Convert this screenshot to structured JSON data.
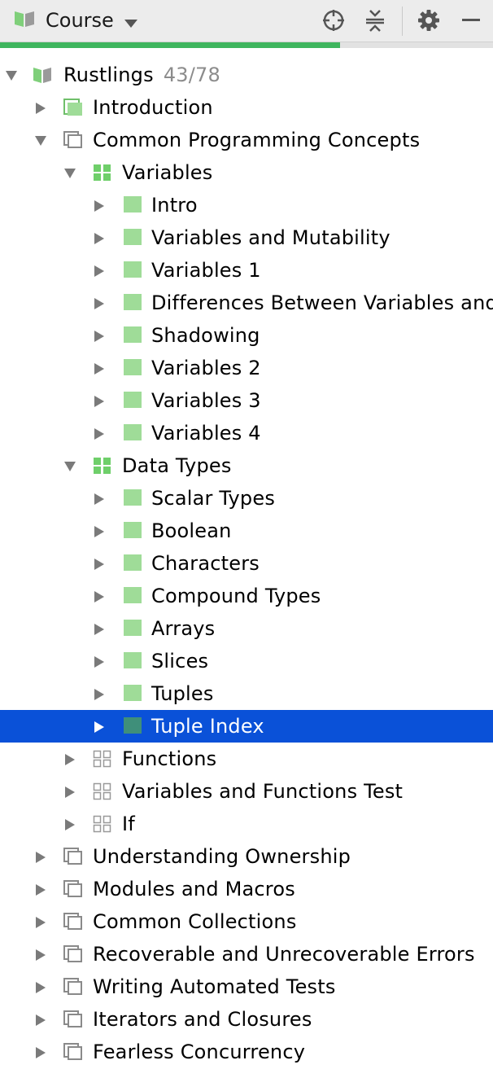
{
  "toolbar": {
    "course_label": "Course",
    "course_icon": "book-icon",
    "buttons": [
      "locate-icon",
      "collapse-all-icon",
      "gear-icon",
      "minimize-icon"
    ]
  },
  "progress": {
    "fraction": 0.69,
    "color": "#3fb55e"
  },
  "colors": {
    "selection": "#0a51d8",
    "solved_green": "#9fdc98",
    "unsolved_gray": "#8a8a8a"
  },
  "tree": [
    {
      "label": "Rustlings",
      "count": "43/78",
      "level": 0,
      "expanded": true,
      "icon": "course-book-icon"
    },
    {
      "label": "Introduction",
      "level": 1,
      "expanded": false,
      "icon": "section-solved-icon"
    },
    {
      "label": "Common Programming Concepts",
      "level": 1,
      "expanded": true,
      "icon": "section-icon"
    },
    {
      "label": "Variables",
      "level": 2,
      "expanded": true,
      "icon": "lesson-solved-icon"
    },
    {
      "label": "Intro",
      "level": 3,
      "expanded": false,
      "icon": "task-solved-icon"
    },
    {
      "label": "Variables and Mutability",
      "level": 3,
      "expanded": false,
      "icon": "task-solved-icon"
    },
    {
      "label": "Variables 1",
      "level": 3,
      "expanded": false,
      "icon": "task-solved-icon"
    },
    {
      "label": "Differences Between Variables and",
      "level": 3,
      "expanded": false,
      "icon": "task-solved-icon"
    },
    {
      "label": "Shadowing",
      "level": 3,
      "expanded": false,
      "icon": "task-solved-icon"
    },
    {
      "label": "Variables 2",
      "level": 3,
      "expanded": false,
      "icon": "task-solved-icon"
    },
    {
      "label": "Variables 3",
      "level": 3,
      "expanded": false,
      "icon": "task-solved-icon"
    },
    {
      "label": "Variables 4",
      "level": 3,
      "expanded": false,
      "icon": "task-solved-icon"
    },
    {
      "label": "Data Types",
      "level": 2,
      "expanded": true,
      "icon": "lesson-solved-icon"
    },
    {
      "label": "Scalar Types",
      "level": 3,
      "expanded": false,
      "icon": "task-solved-icon"
    },
    {
      "label": "Boolean",
      "level": 3,
      "expanded": false,
      "icon": "task-solved-icon"
    },
    {
      "label": "Characters",
      "level": 3,
      "expanded": false,
      "icon": "task-solved-icon"
    },
    {
      "label": "Compound Types",
      "level": 3,
      "expanded": false,
      "icon": "task-solved-icon"
    },
    {
      "label": "Arrays",
      "level": 3,
      "expanded": false,
      "icon": "task-solved-icon"
    },
    {
      "label": "Slices",
      "level": 3,
      "expanded": false,
      "icon": "task-solved-icon"
    },
    {
      "label": "Tuples",
      "level": 3,
      "expanded": false,
      "icon": "task-solved-icon"
    },
    {
      "label": "Tuple Index",
      "level": 3,
      "expanded": false,
      "icon": "task-solved-icon",
      "selected": true
    },
    {
      "label": "Functions",
      "level": 2,
      "expanded": false,
      "icon": "lesson-icon"
    },
    {
      "label": "Variables and Functions Test",
      "level": 2,
      "expanded": false,
      "icon": "lesson-icon"
    },
    {
      "label": "If",
      "level": 2,
      "expanded": false,
      "icon": "lesson-icon"
    },
    {
      "label": "Understanding Ownership",
      "level": 1,
      "expanded": false,
      "icon": "section-icon"
    },
    {
      "label": "Modules and Macros",
      "level": 1,
      "expanded": false,
      "icon": "section-icon"
    },
    {
      "label": "Common Collections",
      "level": 1,
      "expanded": false,
      "icon": "section-icon"
    },
    {
      "label": "Recoverable and Unrecoverable Errors",
      "level": 1,
      "expanded": false,
      "icon": "section-icon"
    },
    {
      "label": "Writing Automated Tests",
      "level": 1,
      "expanded": false,
      "icon": "section-icon"
    },
    {
      "label": "Iterators and Closures",
      "level": 1,
      "expanded": false,
      "icon": "section-icon"
    },
    {
      "label": "Fearless Concurrency",
      "level": 1,
      "expanded": false,
      "icon": "section-icon"
    }
  ]
}
